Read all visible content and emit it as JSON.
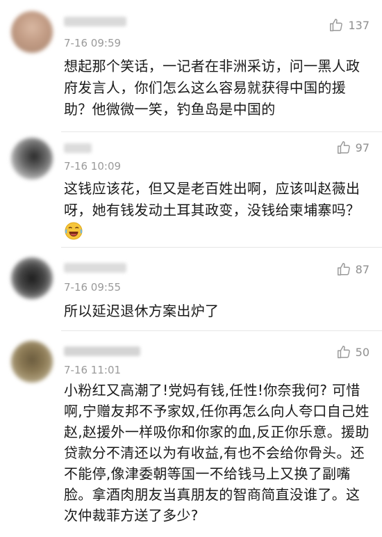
{
  "comments": [
    {
      "time": "7-16 09:59",
      "likes": "137",
      "text": "想起那个笑话，一记者在非洲采访，问一黑人政府发言人，你们怎么这么容易就获得中国的援助？他微微一笑，钓鱼岛是中国的",
      "avatar_color": "#c8a48e"
    },
    {
      "time": "7-16 10:09",
      "likes": "97",
      "text": "这钱应该花，但又是老百姓出啊，应该叫赵薇出呀，她有钱发动土耳其政变，没钱给柬埔寨吗？",
      "avatar_color": "#5a5a5a",
      "emoji": "laughing-crying-emoji"
    },
    {
      "time": "7-16 09:55",
      "likes": "87",
      "text": "所以延迟退休方案出炉了",
      "avatar_color": "#3c3c3c"
    },
    {
      "time": "7-16 11:01",
      "likes": "50",
      "text": "小粉红又高潮了!党妈有钱,任性!你奈我何? 可惜啊,宁赠友邦不予家奴,任你再怎么向人夸口自己姓赵,赵援外一样吸你和你家的血,反正你乐意。援助贷款分不清还以为有收益,有也不会给你骨头。还不能停,像津委朝等国一不给钱马上又换了副嘴脸。拿酒肉朋友当真朋友的智商简直没谁了。这次仲裁菲方送了多少?",
      "avatar_color": "#8a7a5a"
    }
  ]
}
